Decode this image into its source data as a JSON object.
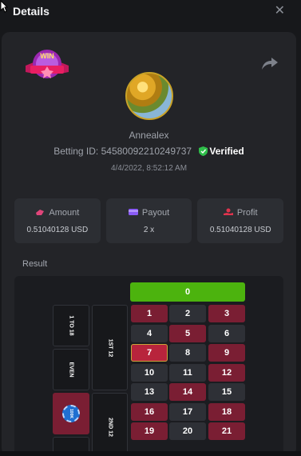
{
  "header": {
    "title": "Details",
    "close_label": "✕"
  },
  "share_icon": "share-icon",
  "badge": {
    "text": "WIN"
  },
  "user": {
    "name": "Annealex",
    "betting_id_label": "Betting ID:",
    "betting_id": "54580092210249737",
    "verified_label": "Verified",
    "date": "4/4/2022, 8:52:12 AM"
  },
  "stats": [
    {
      "label": "Amount",
      "value": "0.51040128 USD",
      "icon": "coins-icon",
      "color": "#e0457a"
    },
    {
      "label": "Payout",
      "value": "2 x",
      "icon": "wallet-icon",
      "color": "#8a5cf6"
    },
    {
      "label": "Profit",
      "value": "0.51040128 USD",
      "icon": "money-hand-icon",
      "color": "#e0334d"
    }
  ],
  "result_label": "Result",
  "board": {
    "zero": "0",
    "rows": [
      [
        "1",
        "2",
        "3"
      ],
      [
        "4",
        "5",
        "6"
      ],
      [
        "7",
        "8",
        "9"
      ],
      [
        "10",
        "11",
        "12"
      ],
      [
        "13",
        "14",
        "15"
      ],
      [
        "16",
        "17",
        "18"
      ],
      [
        "19",
        "20",
        "21"
      ]
    ],
    "side_labels": {
      "low": "1 TO 18",
      "even": "EVEN",
      "first12": "1ST 12",
      "second12": "2ND 12"
    },
    "chip_label": "100K"
  },
  "colors": {
    "green": "#4cb30e",
    "red": "#7a1e33",
    "black": "#2e3036",
    "verified": "#2fbf4a"
  }
}
